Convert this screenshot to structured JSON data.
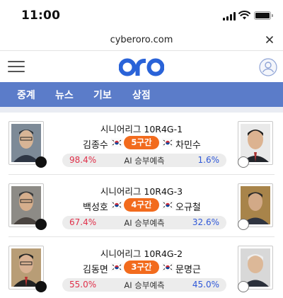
{
  "status_bar": {
    "time": "11:00"
  },
  "url_bar": {
    "url": "cyberoro.com"
  },
  "header": {
    "logo_text": "oro"
  },
  "nav": {
    "items": [
      {
        "label": "중계"
      },
      {
        "label": "뉴스"
      },
      {
        "label": "기보"
      },
      {
        "label": "상점"
      }
    ]
  },
  "colors": {
    "nav_bg": "#5b7cc9",
    "badge": "#f26b1d",
    "left_pct": "#e0304a",
    "right_pct": "#2f58d8",
    "logo": "#2a63d8"
  },
  "prediction_label": "AI 승부예측",
  "matches": [
    {
      "title": "시니어리그 10R4G-1",
      "black_player": "김종수",
      "white_player": "차민수",
      "status": "5구간",
      "black_pct": "98.4%",
      "white_pct": "1.6%"
    },
    {
      "title": "시니어리그 10R4G-3",
      "black_player": "백성호",
      "white_player": "오규철",
      "status": "4구간",
      "black_pct": "67.4%",
      "white_pct": "32.6%"
    },
    {
      "title": "시니어리그 10R4G-2",
      "black_player": "김동면",
      "white_player": "문명근",
      "status": "3구간",
      "black_pct": "55.0%",
      "white_pct": "45.0%"
    }
  ]
}
